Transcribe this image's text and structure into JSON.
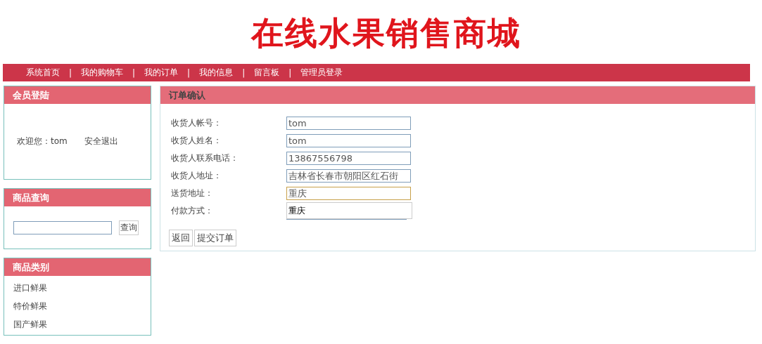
{
  "header": {
    "title": "在线水果销售商城"
  },
  "nav": {
    "separator": "|",
    "items": [
      {
        "label": "系统首页"
      },
      {
        "label": "我的购物车"
      },
      {
        "label": "我的订单"
      },
      {
        "label": "我的信息"
      },
      {
        "label": "留言板"
      },
      {
        "label": "管理员登录"
      }
    ]
  },
  "sidebar": {
    "login": {
      "title": "会员登陆",
      "greeting": "欢迎您：tom",
      "logout": "安全退出"
    },
    "search": {
      "title": "商品查询",
      "button": "查询"
    },
    "categories": {
      "title": "商品类别",
      "items": [
        "进口鲜果",
        "特价鲜果",
        "国产鲜果"
      ]
    }
  },
  "order": {
    "title": "订单确认",
    "fields": [
      {
        "label": "收货人帐号：",
        "value": "tom",
        "focused": false,
        "kind": "text"
      },
      {
        "label": "收货人姓名：",
        "value": "tom",
        "focused": false,
        "kind": "text"
      },
      {
        "label": "收货人联系电话：",
        "value": "13867556798",
        "focused": false,
        "kind": "text"
      },
      {
        "label": "收货人地址：",
        "value": "吉林省长春市朝阳区红石街",
        "focused": false,
        "kind": "text"
      },
      {
        "label": "送货地址：",
        "value": "重庆",
        "focused": true,
        "kind": "text",
        "suggestion": "重庆"
      },
      {
        "label": "付款方式：",
        "kind": "select"
      }
    ],
    "buttons": [
      "返回",
      "提交订单"
    ]
  }
}
